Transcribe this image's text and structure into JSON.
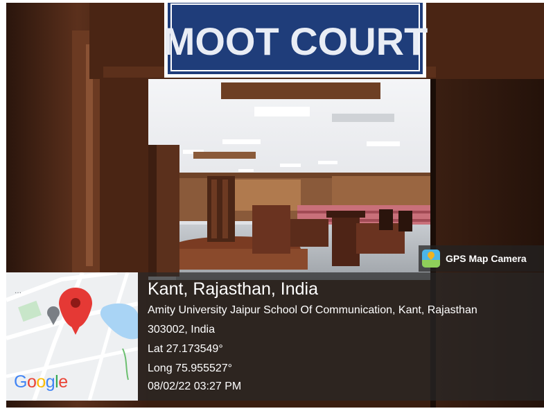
{
  "photo": {
    "sign_text": "MOOT COURT"
  },
  "overlay": {
    "app_name": "GPS Map Camera",
    "app_icon": "gps-map-camera-icon",
    "location_title": "Kant, Rajasthan, India",
    "address_line1": "Amity University Jaipur School Of Communication, Kant, Rajasthan",
    "address_line2": "303002, India",
    "latitude": "Lat 27.173549°",
    "longitude": "Long 75.955527°",
    "datetime": "08/02/22 03:27 PM"
  },
  "map": {
    "logo_text": "Google",
    "pin_icon": "location-pin-icon",
    "colors": {
      "pin": "#e53935",
      "water": "#a9d4f5",
      "park": "#c8e6c9",
      "road": "#ffffff"
    }
  },
  "colors": {
    "sign_background": "#1f3d7a",
    "overlay_background": "rgba(40,40,40,0.70)",
    "text": "#ffffff"
  }
}
